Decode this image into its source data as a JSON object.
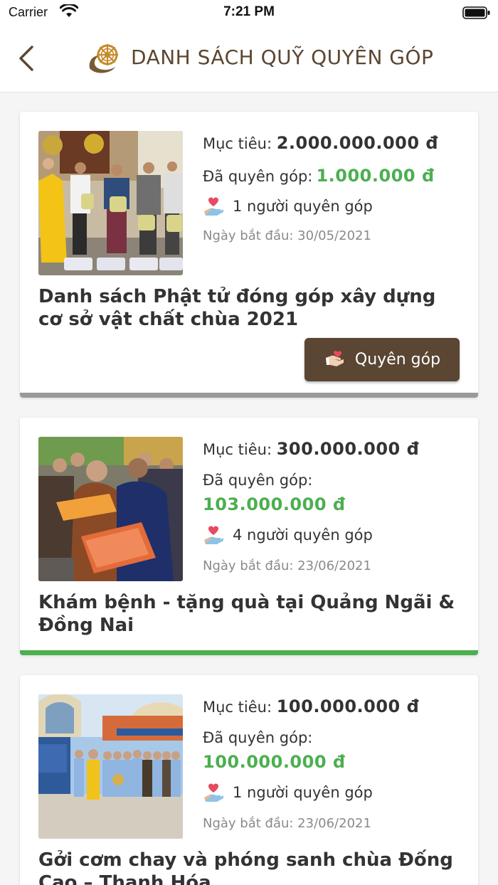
{
  "status_bar": {
    "carrier": "Carrier",
    "time": "7:21 PM"
  },
  "header": {
    "title": "DANH SÁCH QUỸ QUYÊN GÓP",
    "back_icon": "chevron-left-icon",
    "logo": "dharma-wheel-logo"
  },
  "colors": {
    "brand_brown": "#5a4632",
    "raised_green": "#4caf50",
    "title_brown": "#5c4630"
  },
  "funds": [
    {
      "target_label": "Mục tiêu:",
      "target_amount": "2.000.000.000 đ",
      "raised_label": "Đã quyên góp:",
      "raised_amount": "1.000.000 đ",
      "donors": "1 người quyên góp",
      "start_date": "Ngày bắt đầu: 30/05/2021",
      "title": "Danh sách Phật tử đóng góp xây dựng cơ sở vật chất chùa 2021",
      "button_label": "Quyên góp"
    },
    {
      "target_label": "Mục tiêu:",
      "target_amount": "300.000.000 đ",
      "raised_label": "Đã quyên góp:",
      "raised_amount": "103.000.000 đ",
      "donors": "4 người quyên góp",
      "start_date": "Ngày bắt đầu: 23/06/2021",
      "title": "Khám bệnh - tặng quà tại Quảng Ngãi & Đồng Nai"
    },
    {
      "target_label": "Mục tiêu:",
      "target_amount": "100.000.000 đ",
      "raised_label": "Đã quyên góp:",
      "raised_amount": "100.000.000 đ",
      "donors": "1 người quyên góp",
      "start_date": "Ngày bắt đầu: 23/06/2021",
      "title": "Gởi cơm chay và phóng sanh chùa Đống Cao – Thanh Hóa"
    }
  ]
}
